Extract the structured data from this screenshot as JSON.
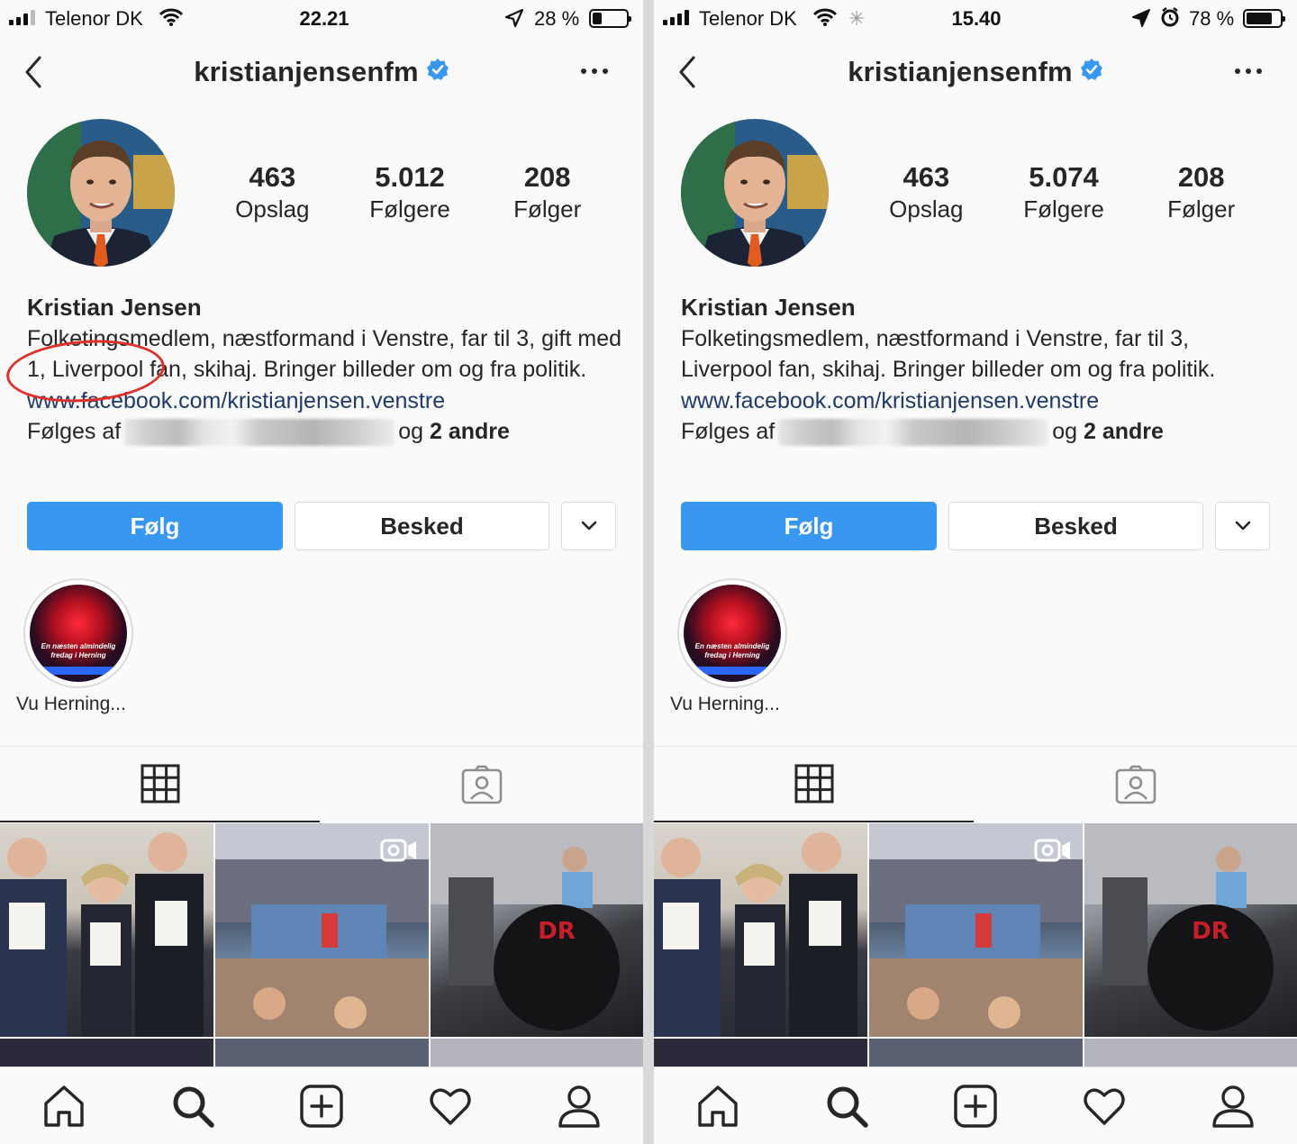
{
  "screens": [
    {
      "status": {
        "carrier": "Telenor DK",
        "time": "22.21",
        "battery": "28 %",
        "battery_level": 0.28
      },
      "header": {
        "username": "kristianjensenfm"
      },
      "stats": {
        "posts_count": "463",
        "posts_label": "Opslag",
        "followers_count": "5.012",
        "followers_label": "Følgere",
        "following_count": "208",
        "following_label": "Følger"
      },
      "bio": {
        "name": "Kristian Jensen",
        "text": "Folketingsmedlem, næstformand i Venstre, far til 3, gift med 1, Liverpool fan, skihaj. Bringer billeder om og fra politik.",
        "link": "www.facebook.com/kristianjensen.venstre",
        "followed_prefix": "Følges af",
        "followed_mid": "og",
        "followed_others": "2 andre"
      },
      "buttons": {
        "follow": "Følg",
        "message": "Besked"
      },
      "highlight": {
        "label": "Vu Herning...",
        "overlay_line1": "En næsten almindelig",
        "overlay_line2": "fredag i Herning"
      }
    },
    {
      "status": {
        "carrier": "Telenor DK",
        "time": "15.40",
        "battery": "78 %",
        "battery_level": 0.78
      },
      "header": {
        "username": "kristianjensenfm"
      },
      "stats": {
        "posts_count": "463",
        "posts_label": "Opslag",
        "followers_count": "5.074",
        "followers_label": "Følgere",
        "following_count": "208",
        "following_label": "Følger"
      },
      "bio": {
        "name": "Kristian Jensen",
        "text": "Folketingsmedlem, næstformand i Venstre, far til 3, Liverpool fan, skihaj. Bringer billeder om og fra politik.",
        "link": "www.facebook.com/kristianjensen.venstre",
        "followed_prefix": "Følges af",
        "followed_mid": "og",
        "followed_others": "2 andre"
      },
      "buttons": {
        "follow": "Følg",
        "message": "Besked"
      },
      "highlight": {
        "label": "Vu Herning...",
        "overlay_line1": "En næsten almindelig",
        "overlay_line2": "fredag i Herning"
      }
    }
  ],
  "colors": {
    "accent": "#3897f0",
    "link": "#1f3a6b",
    "annotation": "#e0302a",
    "verified": "#3897f0"
  },
  "icons": [
    "back-chevron-icon",
    "verified-badge-icon",
    "more-icon",
    "grid-icon",
    "tagged-icon",
    "video-icon",
    "home-icon",
    "search-icon",
    "add-post-icon",
    "heart-icon",
    "profile-icon",
    "wifi-icon",
    "location-arrow-icon",
    "alarm-icon",
    "battery-icon"
  ]
}
